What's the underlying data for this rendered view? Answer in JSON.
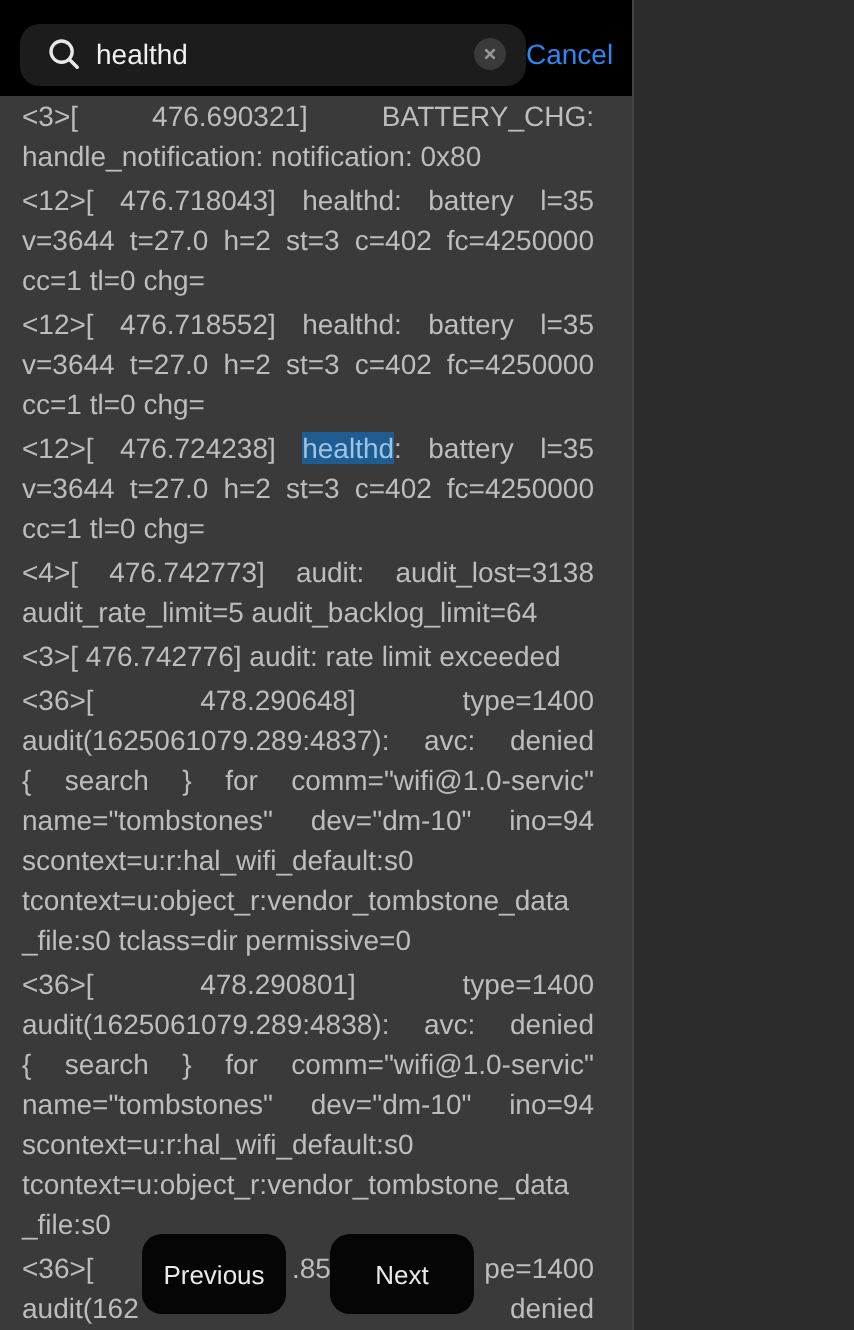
{
  "search": {
    "value": "healthd"
  },
  "cancel": "Cancel",
  "log_entries": [
    {
      "kind": "entry",
      "lines": [
        [
          {
            "text": "<3>[ 476.690321] BATTERY_CHG:",
            "highlighted": false
          }
        ],
        [
          {
            "text": "handle_notification: notification: 0x80",
            "highlighted": false
          }
        ]
      ]
    },
    {
      "kind": "entry",
      "lines": [
        [
          {
            "text": "<12>[ 476.718043] healthd: battery l=35",
            "highlighted": false
          }
        ],
        [
          {
            "text": "v=3644 t=27.0 h=2 st=3 c=402 fc=4250000",
            "highlighted": false
          }
        ],
        [
          {
            "text": "cc=1 tl=0 chg=",
            "highlighted": false
          }
        ]
      ]
    },
    {
      "kind": "entry",
      "lines": [
        [
          {
            "text": "<12>[ 476.718552] healthd: battery l=35",
            "highlighted": false
          }
        ],
        [
          {
            "text": "v=3644 t=27.0 h=2 st=3 c=402 fc=4250000",
            "highlighted": false
          }
        ],
        [
          {
            "text": "cc=1 tl=0 chg=",
            "highlighted": false
          }
        ]
      ]
    },
    {
      "kind": "entry",
      "lines": [
        [
          {
            "text": "<12>[ 476.724238] ",
            "highlighted": false
          },
          {
            "text": "healthd",
            "highlighted": true
          },
          {
            "text": ": battery l=35",
            "highlighted": false
          }
        ],
        [
          {
            "text": "v=3644 t=27.0 h=2 st=3 c=402 fc=4250000",
            "highlighted": false
          }
        ],
        [
          {
            "text": "cc=1 tl=0 chg=",
            "highlighted": false
          }
        ]
      ]
    },
    {
      "kind": "entry",
      "lines": [
        [
          {
            "text": "<4>[ 476.742773] audit: audit_lost=3138",
            "highlighted": false
          }
        ],
        [
          {
            "text": "audit_rate_limit=5 audit_backlog_limit=64",
            "highlighted": false
          }
        ]
      ]
    },
    {
      "kind": "entry",
      "lines": [
        [
          {
            "text": "<3>[ 476.742776] audit: rate limit exceeded",
            "highlighted": false
          }
        ]
      ]
    },
    {
      "kind": "entry",
      "lines": [
        [
          {
            "text": "<36>[ 478.290648] type=1400",
            "highlighted": false
          }
        ],
        [
          {
            "text": "audit(1625061079.289:4837): avc: denied",
            "highlighted": false
          }
        ],
        [
          {
            "text": "{ search } for comm=\"wifi@1.0-servic\"",
            "highlighted": false
          }
        ],
        [
          {
            "text": "name=\"tombstones\" dev=\"dm-10\" ino=94",
            "highlighted": false
          }
        ],
        [
          {
            "text": "scontext=u:r:hal_wifi_default:s0",
            "highlighted": false
          }
        ],
        [
          {
            "text": "tcontext=u:object_r:vendor_tombstone_data",
            "highlighted": false
          }
        ],
        [
          {
            "text": "_file:s0 tclass=dir permissive=0",
            "highlighted": false
          }
        ]
      ]
    },
    {
      "kind": "entry",
      "lines": [
        [
          {
            "text": "<36>[ 478.290801] type=1400",
            "highlighted": false
          }
        ],
        [
          {
            "text": "audit(1625061079.289:4838): avc: denied",
            "highlighted": false
          }
        ],
        [
          {
            "text": "{ search } for comm=\"wifi@1.0-servic\"",
            "highlighted": false
          }
        ],
        [
          {
            "text": "name=\"tombstones\" dev=\"dm-10\" ino=94",
            "highlighted": false
          }
        ],
        [
          {
            "text": "scontext=u:r:hal_wifi_default:s0",
            "highlighted": false
          }
        ],
        [
          {
            "text": "tcontext=u:object_r:vendor_tombstone_data",
            "highlighted": false
          }
        ],
        [
          {
            "text": "_file:s0",
            "highlighted": false
          }
        ]
      ]
    },
    {
      "kind": "partial",
      "lines": [
        [
          "<36>[",
          ".85",
          "pe=1400"
        ],
        [
          "audit(162",
          "denied"
        ]
      ]
    }
  ],
  "nav_buttons": [
    "Previous",
    "Next"
  ]
}
